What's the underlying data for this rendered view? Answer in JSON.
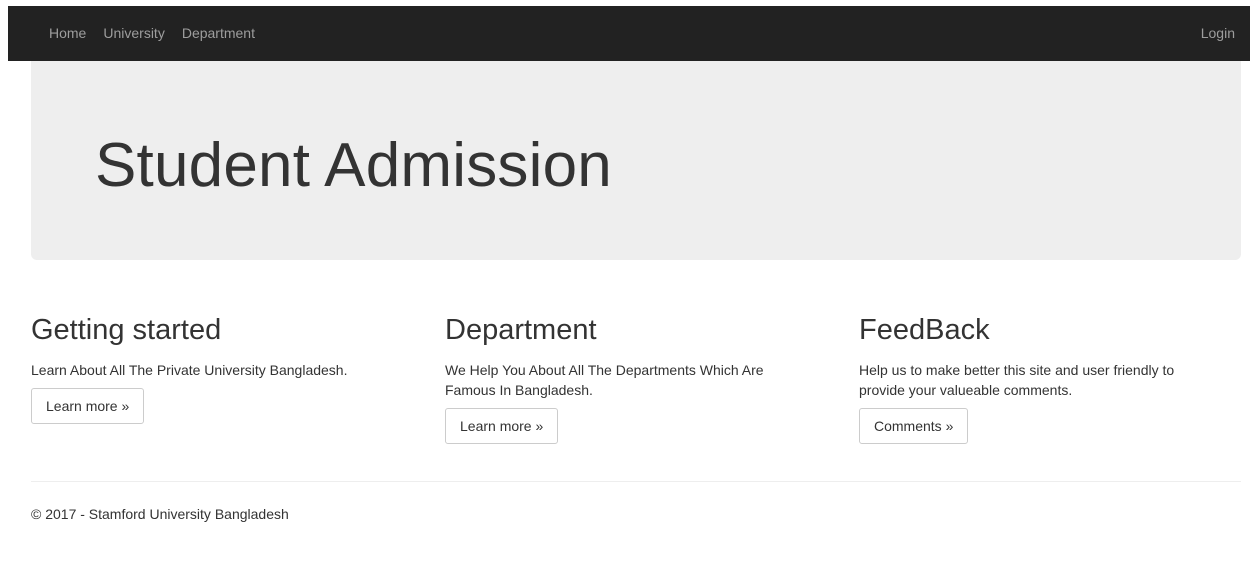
{
  "navbar": {
    "links": [
      "Home",
      "University",
      "Department"
    ],
    "login_label": "Login"
  },
  "jumbotron": {
    "title": "Student Admission"
  },
  "columns": [
    {
      "heading": "Getting started",
      "text": "Learn About All The Private University Bangladesh.",
      "button": "Learn more »"
    },
    {
      "heading": "Department",
      "text": "We Help You About All The Departments Which Are Famous In Bangladesh.",
      "button": "Learn more »"
    },
    {
      "heading": "FeedBack",
      "text": "Help us to make better this site and user friendly to provide your valueable comments.",
      "button": "Comments »"
    }
  ],
  "footer": {
    "text": "© 2017 - Stamford University Bangladesh"
  },
  "colors": {
    "navbar_bg": "#222222",
    "nav_link": "#9d9d9d",
    "jumbotron_bg": "#eeeeee",
    "text": "#333333"
  }
}
